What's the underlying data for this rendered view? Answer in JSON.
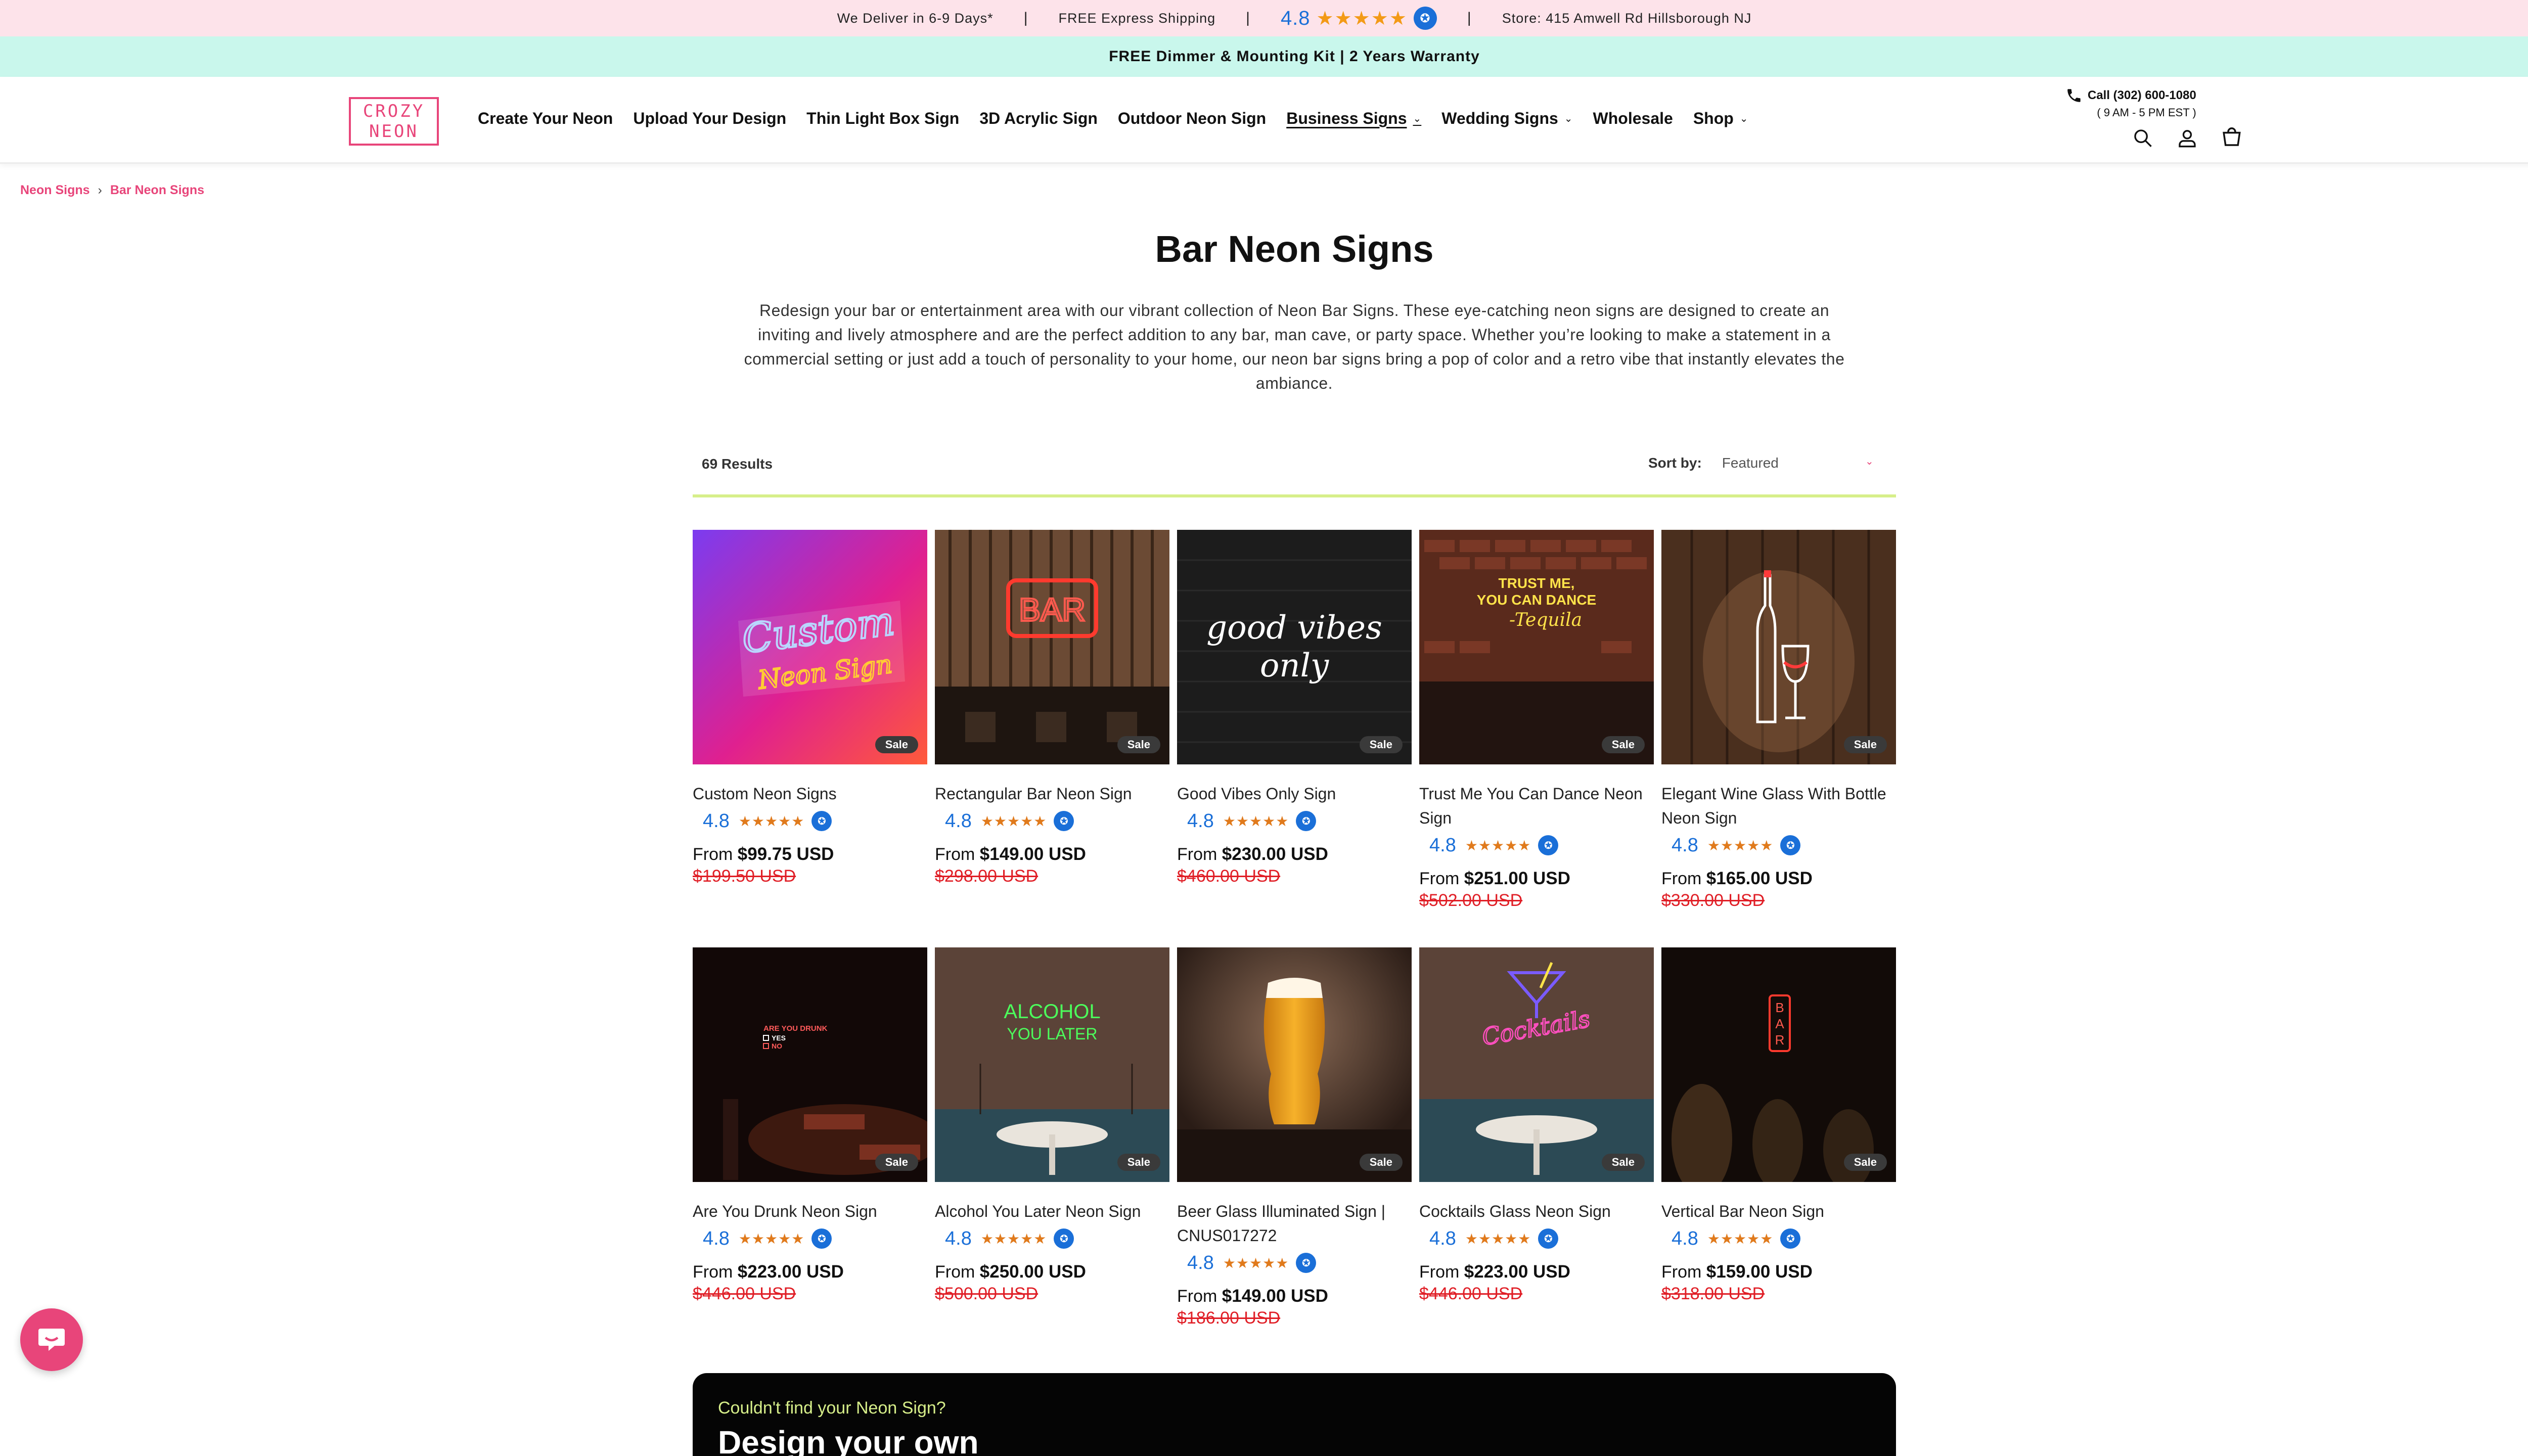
{
  "topbar": {
    "delivery": "We Deliver in 6-9 Days*",
    "shipping": "FREE Express Shipping",
    "rating": "4.8",
    "stars": "★★★★★",
    "badge": "✪",
    "store": "Store: 415 Amwell Rd Hillsborough NJ",
    "sep": "|"
  },
  "subbar": {
    "text": "FREE Dimmer & Mounting Kit | 2 Years Warranty"
  },
  "header": {
    "logo_top": "CROZY",
    "logo_bottom": "NEON",
    "nav": [
      {
        "label": "Create Your Neon",
        "dropdown": false
      },
      {
        "label": "Upload Your Design",
        "dropdown": false
      },
      {
        "label": "Thin Light Box Sign",
        "dropdown": false
      },
      {
        "label": "3D Acrylic Sign",
        "dropdown": false
      },
      {
        "label": "Outdoor Neon Sign",
        "dropdown": false
      },
      {
        "label": "Business Signs",
        "dropdown": true
      },
      {
        "label": "Wedding Signs",
        "dropdown": true
      },
      {
        "label": "Wholesale",
        "dropdown": false
      },
      {
        "label": "Shop",
        "dropdown": true
      }
    ],
    "chevron": "⌄",
    "call": "Call (302) 600-1080",
    "hours": "( 9 AM - 5 PM EST )"
  },
  "breadcrumb": {
    "home": "Neon Signs",
    "current": "Bar Neon Signs",
    "sep": "›"
  },
  "page": {
    "title": "Bar Neon Signs",
    "description": "Redesign your bar or entertainment area with our vibrant collection of Neon Bar Signs. These eye-catching neon signs are designed to create an inviting and lively atmosphere and are the perfect addition to any bar, man cave, or party space. Whether you’re looking to make a statement in a commercial setting or just add a touch of personality to your home, our neon bar signs bring a pop of color and a retro vibe that instantly elevates the ambiance."
  },
  "results": {
    "count": "69 Results",
    "sort_label": "Sort by:",
    "sort_value": "Featured",
    "chevron": "⌄"
  },
  "products": [
    {
      "name": "Custom Neon Signs",
      "rating": "4.8",
      "price_prefix": "From ",
      "price": "$99.75 USD",
      "old_price": "$199.50 USD",
      "sale": "Sale",
      "stars": "★★★★★",
      "badge": "✪"
    },
    {
      "name": "Rectangular Bar Neon Sign",
      "rating": "4.8",
      "price_prefix": "From ",
      "price": "$149.00 USD",
      "old_price": "$298.00 USD",
      "sale": "Sale",
      "stars": "★★★★★",
      "badge": "✪"
    },
    {
      "name": "Good Vibes Only Sign",
      "rating": "4.8",
      "price_prefix": "From ",
      "price": "$230.00 USD",
      "old_price": "$460.00 USD",
      "sale": "Sale",
      "stars": "★★★★★",
      "badge": "✪"
    },
    {
      "name": "Trust Me You Can Dance Neon Sign",
      "rating": "4.8",
      "price_prefix": "From ",
      "price": "$251.00 USD",
      "old_price": "$502.00 USD",
      "sale": "Sale",
      "stars": "★★★★★",
      "badge": "✪"
    },
    {
      "name": "Elegant Wine Glass With Bottle Neon Sign",
      "rating": "4.8",
      "price_prefix": "From ",
      "price": "$165.00 USD",
      "old_price": "$330.00 USD",
      "sale": "Sale",
      "stars": "★★★★★",
      "badge": "✪"
    },
    {
      "name": "Are You Drunk Neon Sign",
      "rating": "4.8",
      "price_prefix": "From ",
      "price": "$223.00 USD",
      "old_price": "$446.00 USD",
      "sale": "Sale",
      "stars": "★★★★★",
      "badge": "✪"
    },
    {
      "name": "Alcohol You Later Neon Sign",
      "rating": "4.8",
      "price_prefix": "From ",
      "price": "$250.00 USD",
      "old_price": "$500.00 USD",
      "sale": "Sale",
      "stars": "★★★★★",
      "badge": "✪"
    },
    {
      "name": "Beer Glass Illuminated Sign | CNUS017272",
      "rating": "4.8",
      "price_prefix": "From ",
      "price": "$149.00 USD",
      "old_price": "$186.00 USD",
      "sale": "Sale",
      "stars": "★★★★★",
      "badge": "✪"
    },
    {
      "name": "Cocktails Glass Neon Sign",
      "rating": "4.8",
      "price_prefix": "From ",
      "price": "$223.00 USD",
      "old_price": "$446.00 USD",
      "sale": "Sale",
      "stars": "★★★★★",
      "badge": "✪"
    },
    {
      "name": "Vertical Bar Neon Sign",
      "rating": "4.8",
      "price_prefix": "From ",
      "price": "$159.00 USD",
      "old_price": "$318.00 USD",
      "sale": "Sale",
      "stars": "★★★★★",
      "badge": "✪"
    }
  ],
  "images": {
    "custom": {
      "line1": "Custom",
      "line2": "Neon Sign"
    },
    "bar": {
      "text": "BAR"
    },
    "vibes": {
      "line1": "good vibes",
      "line2": "only"
    },
    "dance": {
      "line1": "TRUST ME,",
      "line2": "YOU CAN DANCE",
      "line3": "-Tequila"
    },
    "drunk": {
      "line1": "ARE YOU DRUNK",
      "line2": "YES",
      "line3": "NO"
    },
    "alcohol": {
      "line1": "ALCOHOL",
      "line2": "YOU LATER"
    },
    "cocktails": {
      "text": "Cocktails"
    },
    "vbar": {
      "l1": "B",
      "l2": "A",
      "l3": "R"
    }
  },
  "banner": {
    "question": "Couldn't find your Neon Sign?",
    "headline": "Design your own"
  },
  "colors": {
    "accent": "#e8457a",
    "rating_blue": "#1a6fd8",
    "star_orange": "#e07a1c",
    "sale_red": "#e01e26",
    "rule": "#d7ef8a"
  }
}
